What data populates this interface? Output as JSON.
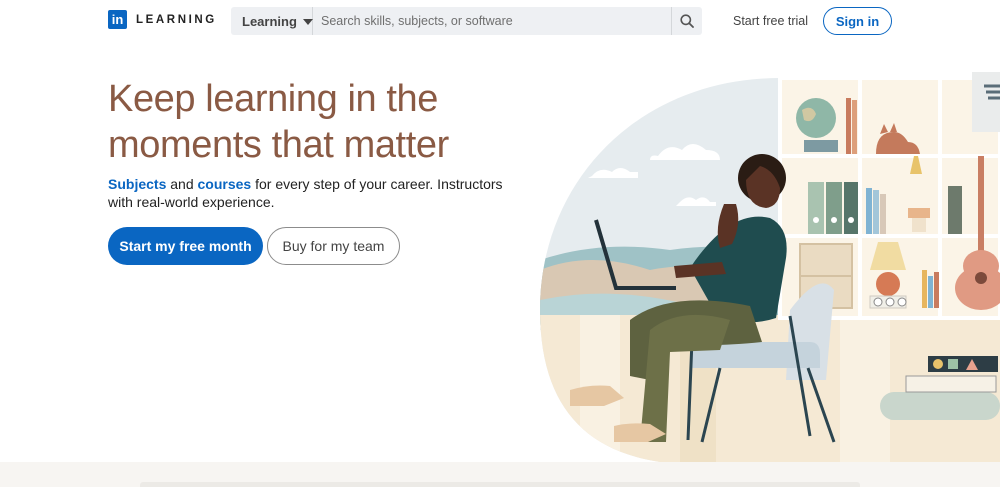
{
  "header": {
    "logo_mark": "in",
    "logo_text": "LEARNING",
    "search_category": "Learning",
    "search_placeholder": "Search skills, subjects, or software",
    "start_trial": "Start free trial",
    "sign_in": "Sign in"
  },
  "hero": {
    "headline": "Keep learning in the moments that matter",
    "sub_link_1": "Subjects",
    "sub_and": " and ",
    "sub_link_2": "courses",
    "sub_rest": " for every step of your career. Instructors with real-world experience.",
    "primary_button": "Start my free month",
    "secondary_button": "Buy for my team"
  },
  "icons": {
    "search": "search-icon",
    "dropdown": "caret-down-icon"
  },
  "colors": {
    "brand_blue": "#0a66c2",
    "headline_brown": "#8a5a44",
    "search_bg": "#eef0f3"
  }
}
